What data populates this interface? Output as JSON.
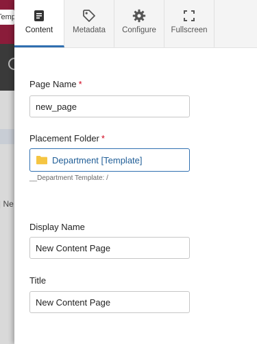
{
  "background": {
    "header_text": "Templ",
    "fragment_text": "| Ne"
  },
  "tabs": [
    {
      "label": "Content",
      "icon": "document-icon",
      "active": true
    },
    {
      "label": "Metadata",
      "icon": "tag-icon",
      "active": false
    },
    {
      "label": "Configure",
      "icon": "gear-icon",
      "active": false
    },
    {
      "label": "Fullscreen",
      "icon": "fullscreen-icon",
      "active": false
    }
  ],
  "form": {
    "page_name": {
      "label": "Page Name",
      "required_marker": "*",
      "value": "new_page"
    },
    "placement_folder": {
      "label": "Placement Folder",
      "required_marker": "*",
      "value": "Department [Template]",
      "hint": "__Department Template: /"
    },
    "display_name": {
      "label": "Display Name",
      "value": "New Content Page"
    },
    "title": {
      "label": "Title",
      "value": "New Content Page"
    }
  },
  "colors": {
    "accent": "#2f6fb0",
    "required": "#d0021b",
    "folder_icon": "#f5c542",
    "background_header": "#8a1c3a"
  }
}
